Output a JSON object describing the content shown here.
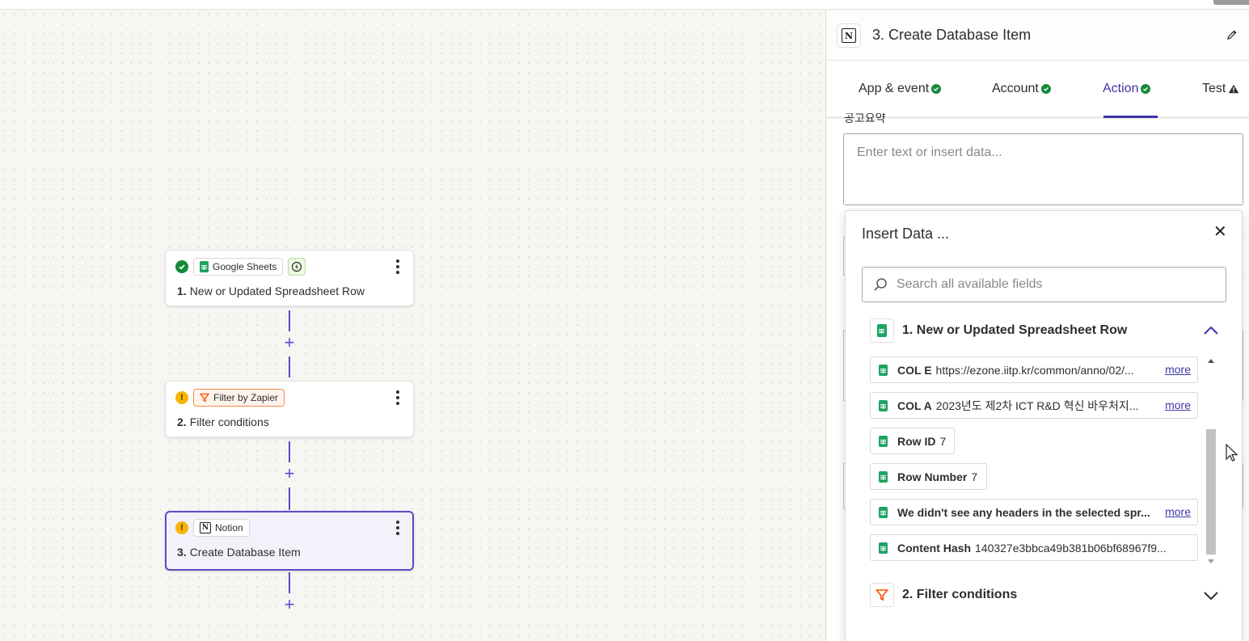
{
  "canvas": {
    "steps": [
      {
        "status": "ok",
        "app": "Google Sheets",
        "number": "1.",
        "title": "New or Updated Spreadsheet Row"
      },
      {
        "status": "warning",
        "app": "Filter by Zapier",
        "number": "2.",
        "title": "Filter conditions"
      },
      {
        "status": "warning",
        "app": "Notion",
        "number": "3.",
        "title": "Create Database Item"
      }
    ],
    "add_step_symbol": "+"
  },
  "panel": {
    "app_icon": "N",
    "title": "3. Create Database Item",
    "tabs": [
      {
        "label": "App & event",
        "status": "complete"
      },
      {
        "label": "Account",
        "status": "complete"
      },
      {
        "label": "Action",
        "status": "complete",
        "active": true
      },
      {
        "label": "Test",
        "status": "warning"
      }
    ],
    "field_label": "공고요약",
    "field_placeholder": "Enter text or insert data..."
  },
  "insert_data": {
    "title": "Insert Data ...",
    "close_symbol": "✕",
    "search_placeholder": "Search all available fields",
    "groups": [
      {
        "title": "1. New or Updated Spreadsheet Row",
        "expanded": true,
        "items": [
          {
            "key": "COL E",
            "value": "https://ezone.iitp.kr/common/anno/02/...",
            "more": "more"
          },
          {
            "key": "COL A",
            "value": "2023년도 제2차 ICT R&D 혁신 바우처지...",
            "more": "more"
          },
          {
            "key": "Row ID",
            "value": "7"
          },
          {
            "key": "Row Number",
            "value": "7"
          },
          {
            "key": "We didn't see any headers in the selected spr...",
            "value": "",
            "more": "more"
          },
          {
            "key": "Content Hash",
            "value": "140327e3bbca49b381b06bf68967f9..."
          }
        ]
      },
      {
        "title": "2. Filter conditions",
        "expanded": false
      }
    ]
  },
  "colors": {
    "accent": "#3d36a6",
    "success": "#138a3b",
    "warning": "#f7b500",
    "sheets_green": "#1ea362",
    "filter_orange": "#ff4a00"
  }
}
